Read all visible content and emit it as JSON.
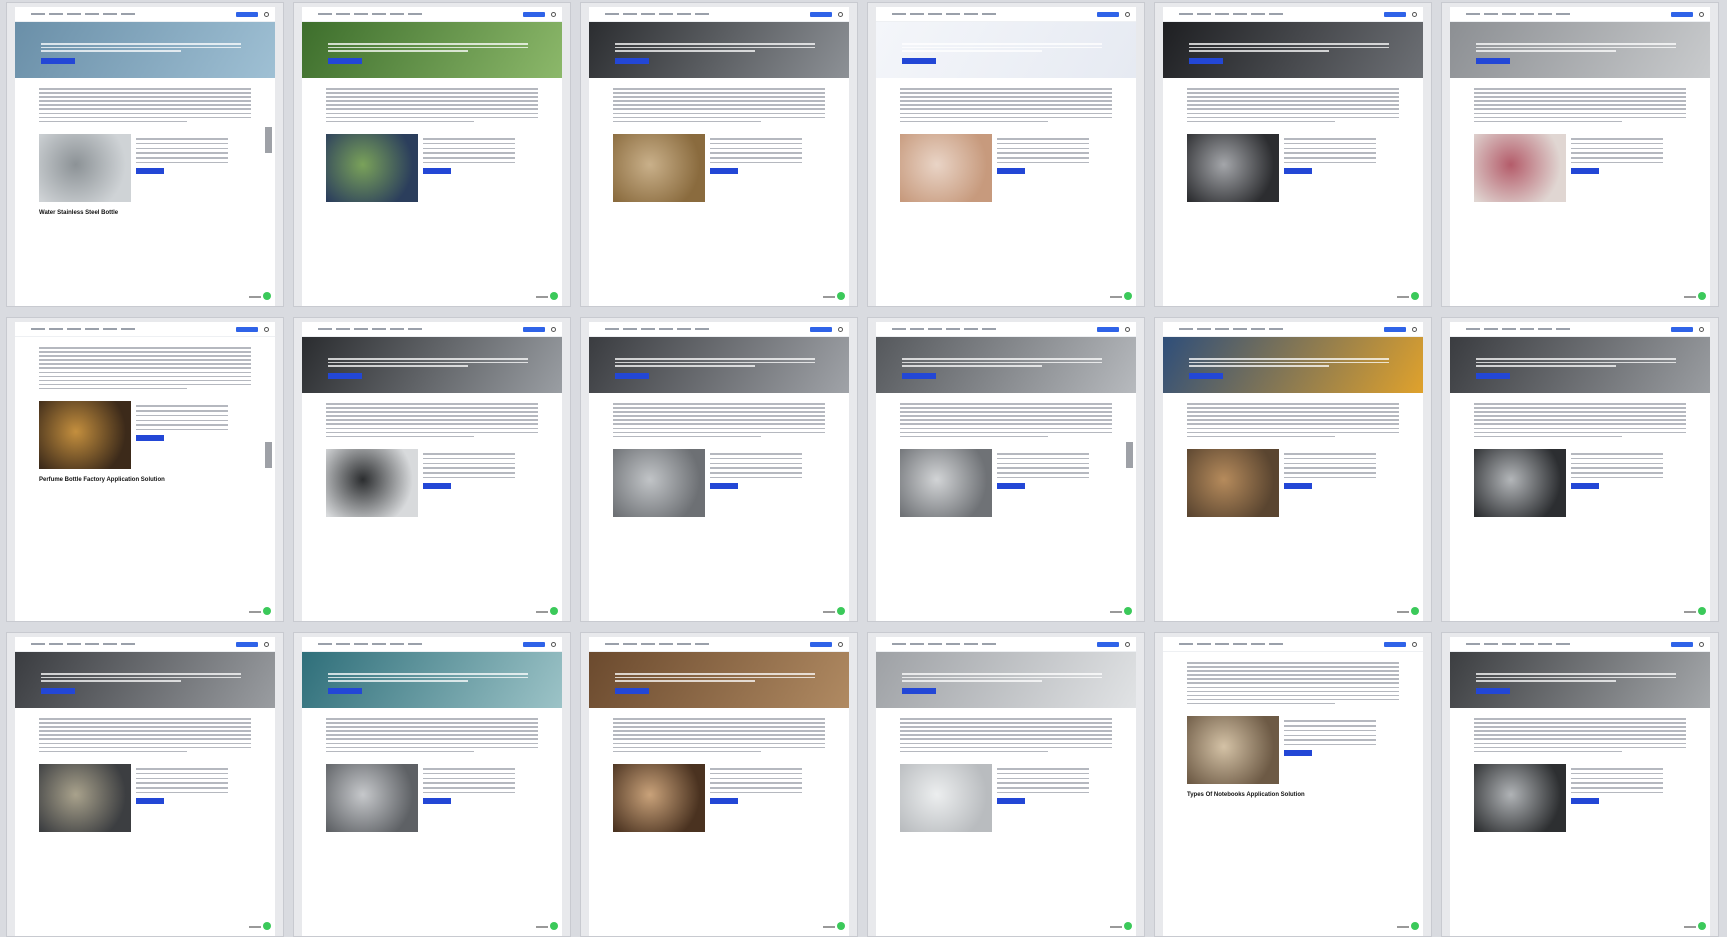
{
  "logo_text": "SourcifyChina",
  "logo_alt": "SourcifyChina",
  "cards": [
    {
      "hero": "SourcifyChina Water Stainless Steel Bottle",
      "h2": "Your Water Stainless Steel Bottle Supplier",
      "h3": "Water Stainless Steel Bottle Type Options",
      "theme": [
        "#6a8fa8",
        "#9fc0d4"
      ],
      "thumb": [
        "#cfd3d6",
        "#8c9296"
      ]
    },
    {
      "hero": "SourcifyChina Solar Water Pumps",
      "h2": "Your Solar Water Pumps Supplier",
      "h3": "Solar Water Pumps Type Options",
      "theme": [
        "#3d6e2c",
        "#8cb86a"
      ],
      "thumb": [
        "#2b3e5c",
        "#7aa25a"
      ]
    },
    {
      "hero": "SourcifyChina Valve For Flow Control",
      "h2": "Your Valve For Flow Control Supplier",
      "h3": "Valve For Flow Control Type Options",
      "theme": [
        "#2b2d30",
        "#8d9196"
      ],
      "thumb": [
        "#8a6b3e",
        "#c9b08a"
      ]
    },
    {
      "hero": "SourcifyChina Intra Oral Camera With Screen",
      "h2": "Your Intra Oral Camera With Screen Supplier",
      "h3": "Intra Oral Camera With Screen Type Options",
      "theme": [
        "#f4f6fa",
        "#e6eaf2"
      ],
      "thumb": [
        "#c79a7d",
        "#e9d4c6"
      ]
    },
    {
      "hero": "SourcifyChina Custom Cable Usb",
      "h2": "Your Custom Cable Usb Supplier",
      "h3": "Custom Cable Usb Type Options",
      "theme": [
        "#1e1f22",
        "#6d7075"
      ],
      "thumb": [
        "#2c2d30",
        "#a4a6aa"
      ]
    },
    {
      "hero": "SourcifyChina Perfume Bottle",
      "h2": "Your Perfume Bottle Supplier",
      "h3": "Perfume Bottle Type Options",
      "theme": [
        "#8c8f93",
        "#c9cbcd"
      ],
      "thumb": [
        "#e0d6d2",
        "#b45c6a"
      ]
    },
    {
      "hero": "",
      "h2": "Your Perfume Bottle Factory Supplier",
      "h3": "Perfume Bottle Factory Type Options",
      "theme": [
        "#ffffff",
        "#ffffff"
      ],
      "thumb": [
        "#3c2a1a",
        "#c48f3e"
      ]
    },
    {
      "hero": "SourcifyChina Electric Bike Under $300",
      "h2": "Your Electric Bike Under $300 Supplier",
      "h3": "Electric Bike Under $300 Type Options",
      "theme": [
        "#2a2c2f",
        "#9a9ea3"
      ],
      "thumb": [
        "#d8dadc",
        "#2b2d2f"
      ]
    },
    {
      "hero": "SourcifyChina Ventilation Duct",
      "h2": "Your Ventilation Duct Supplier",
      "h3": "Ventilation Duct Type Options",
      "theme": [
        "#3a3c40",
        "#a0a3a8"
      ],
      "thumb": [
        "#6d7074",
        "#c1c4c7"
      ]
    },
    {
      "hero": "SourcifyChina Stainless Steel Tank",
      "h2": "Your Stainless Steel Tank Supplier",
      "h3": "Stainless Steel Tank Type Options",
      "theme": [
        "#55585c",
        "#b7babe"
      ],
      "thumb": [
        "#6f7276",
        "#d2d4d6"
      ]
    },
    {
      "hero": "SourcifyChina O Ring Hydraulic",
      "h2": "Your O Ring Hydraulic Supplier",
      "h3": "O Ring Hydraulic Type Options",
      "theme": [
        "#2e4e7a",
        "#e0a22c"
      ],
      "thumb": [
        "#5a4530",
        "#b68b5c"
      ]
    },
    {
      "hero": "SourcifyChina Machining Cnc",
      "h2": "Your Machining Cnc Supplier",
      "h3": "Machining Cnc Type Options",
      "theme": [
        "#3a3c40",
        "#9a9da1"
      ],
      "thumb": [
        "#2c2e31",
        "#b3b6b9"
      ]
    },
    {
      "hero": "SourcifyChina Valve Accessories",
      "h2": "Your Valve Accessories Supplier",
      "h3": "Valve Accessories Type Options",
      "theme": [
        "#3a3c40",
        "#9a9da1"
      ],
      "thumb": [
        "#3c3e41",
        "#a9a28c"
      ]
    },
    {
      "hero": "SourcifyChina Screw Manufacturer In China",
      "h2": "Your Screw Manufacturer In China Supplier",
      "h3": "Screw Manufacturer In China Type Options",
      "theme": [
        "#2f6f7a",
        "#9cc3c7"
      ],
      "thumb": [
        "#5e6165",
        "#c6c8cb"
      ]
    },
    {
      "hero": "SourcifyChina Chair Manufacturer",
      "h2": "Your Chair Manufacturer Supplier",
      "h3": "Chair Manufacturer Type Options",
      "theme": [
        "#6b4a2e",
        "#b08a62"
      ],
      "thumb": [
        "#4a3220",
        "#c9a27a"
      ]
    },
    {
      "hero": "SourcifyChina Pvc Pipe Fittings",
      "h2": "Your Pvc Pipe Fittings Supplier",
      "h3": "Pvc Pipe Fittings Type Options",
      "theme": [
        "#9ea1a5",
        "#e1e3e5"
      ],
      "thumb": [
        "#b9bcbf",
        "#eceeef"
      ]
    },
    {
      "hero": "",
      "h2": "Your Reliable Notebooks Supplier In China",
      "h3": "Types Of Notebooks",
      "theme": [
        "#ffffff",
        "#ffffff"
      ],
      "thumb": [
        "#6d5a45",
        "#d4c2a6"
      ]
    },
    {
      "hero": "SourcifyChina Fasteners Manufacturer",
      "h2": "Your Fasteners Manufacturer Supplier",
      "h3": "Fasteners Manufacturer Type Options",
      "theme": [
        "#3c3e41",
        "#a5a8ab"
      ],
      "thumb": [
        "#2d2f31",
        "#b0b3b6"
      ]
    }
  ],
  "extra_headings": {
    "card0_bottom": "Water Stainless Steel Bottle",
    "card6_bottom": "Perfume Bottle Factory Application Solution",
    "card16_bottom": "Types Of Notebooks Application Solution"
  }
}
